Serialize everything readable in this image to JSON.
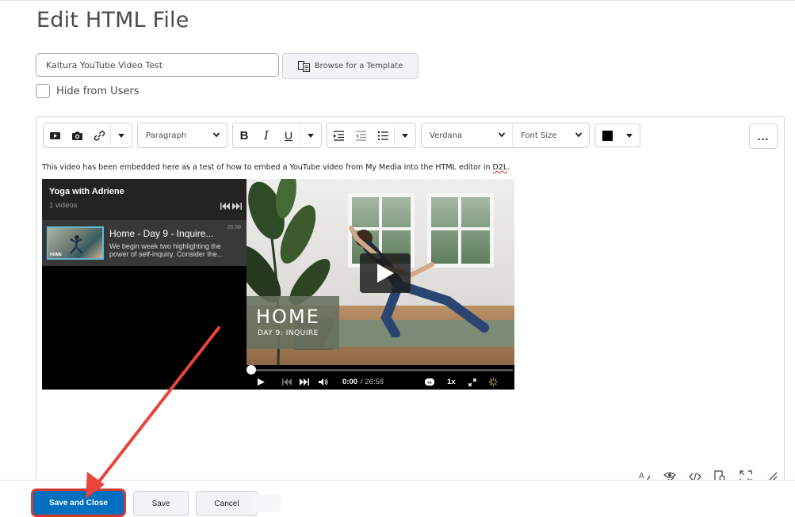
{
  "page": {
    "title": "Edit HTML File"
  },
  "form": {
    "title_value": "Kaltura YouTube Video Test",
    "browse_template_label": "Browse for a Template",
    "hide_label": "Hide from Users"
  },
  "toolbar": {
    "icons": [
      "video-icon",
      "camera-icon",
      "link-icon",
      "caret-down-icon"
    ],
    "block_format": "Paragraph",
    "bold": "B",
    "italic": "I",
    "underline": "U",
    "font_family": "Verdana",
    "font_size": "Font Size",
    "text_color": "#000000",
    "more": "..."
  },
  "content": {
    "text_main": "This video has been embedded here as a test of how to embed a YouTube video from My Media into the HTML editor in ",
    "text_link": "D2L",
    "text_end": "."
  },
  "embed": {
    "playlist_title": "Yoga with Adriene",
    "playlist_count": "1 videos",
    "item_title": "Home - Day 9 - Inquire...",
    "item_duration": "26:58",
    "item_desc": "We begin week two highlighting the power of self-inquiry. Consider the...",
    "thumb_label": "HOME",
    "overlay_title": "HOME",
    "overlay_subtitle": "DAY 9: INQUIRE",
    "time_current": "0:00",
    "time_total": "/ 26:58",
    "speed": "1x",
    "progress": 0.0
  },
  "status_icons": [
    "spellcheck-icon",
    "accessibility-icon",
    "source-code-icon",
    "preview-icon",
    "fullscreen-icon",
    "resize-icon"
  ],
  "footer": {
    "save_close_label": "Save and Close",
    "save_label": "Save",
    "cancel_label": "Cancel"
  },
  "colors": {
    "primary": "#006fbf",
    "annotation": "#d23b2f"
  }
}
